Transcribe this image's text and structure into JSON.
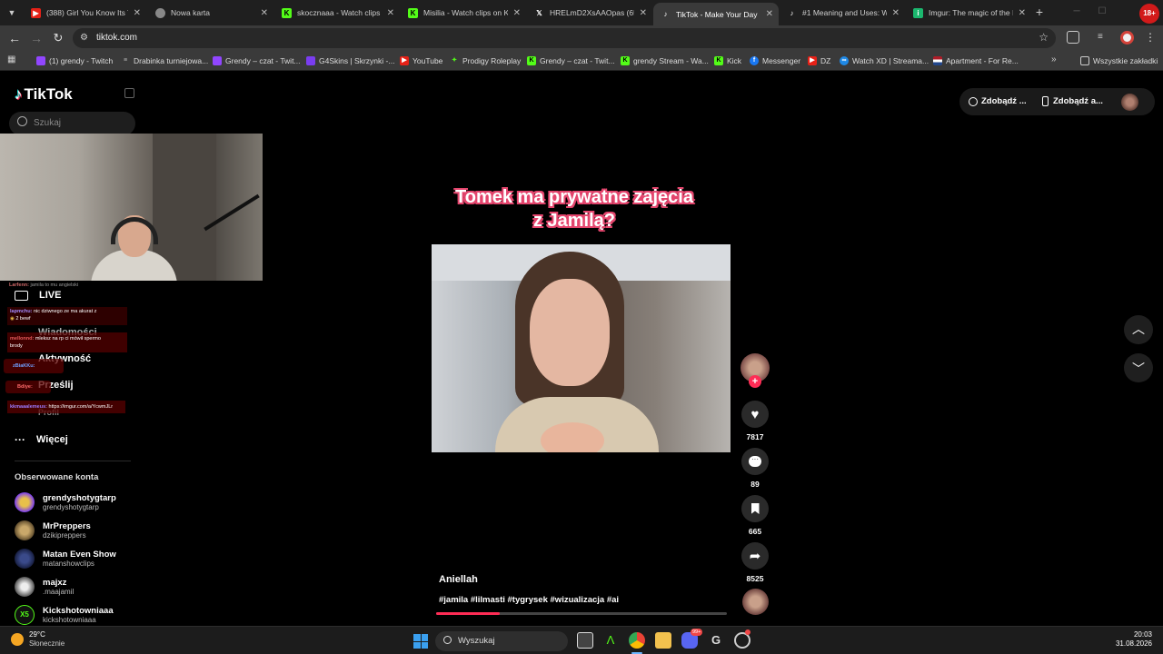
{
  "browser": {
    "tabs": [
      {
        "title": "(388) Girl You Know Its Tr",
        "icon": "youtube-icon"
      },
      {
        "title": "Nowa karta",
        "icon": "chrome-icon"
      },
      {
        "title": "skocznaaa - Watch clips o",
        "icon": "kick-icon"
      },
      {
        "title": "Misilia - Watch clips on K",
        "icon": "kick-icon"
      },
      {
        "title": "HRELmD2XsAAOpas (658",
        "icon": "x-icon"
      },
      {
        "title": "TikTok - Make Your Day",
        "icon": "tiktok-icon"
      },
      {
        "title": "#1 Meaning and Uses: W",
        "icon": "tiktok-icon"
      },
      {
        "title": "Imgur: The magic of the I",
        "icon": "imgur-icon"
      }
    ],
    "url": "tiktok.com",
    "bookmarks": [
      "(1) grendy - Twitch",
      "Drabinka turniejowa...",
      "Grendy – czat - Twit...",
      "G4Skins | Skrzynki -...",
      "YouTube",
      "Prodigy Roleplay",
      "Grendy – czat - Twit...",
      "grendy Stream - Wa...",
      "Kick",
      "Messenger",
      "DZ",
      "Watch XD | Streama...",
      "Apartment - For Re..."
    ],
    "all_bookmarks": "Wszystkie zakładki",
    "profile_badge": "18+"
  },
  "tiktok": {
    "logo": "TikTok",
    "search_placeholder": "Szukaj",
    "nav": [
      "LIVE",
      "Wiadomości",
      "Aktywność",
      "Prześlij",
      "Profil",
      "Więcej"
    ],
    "following_heading": "Obserwowane konta",
    "accounts": [
      {
        "name": "grendyshotygtarp",
        "handle": "grendyshotygtarp"
      },
      {
        "name": "MrPreppers",
        "handle": "dzikipreppers"
      },
      {
        "name": "Matan Even Show",
        "handle": "matanshowclips"
      },
      {
        "name": "majxz",
        "handle": ".maajamil"
      },
      {
        "name": "Kickshotowniaaa",
        "handle": "kickshotowniaaa"
      }
    ],
    "header_buttons": [
      "Zdobądź ...",
      "Zdobądź a..."
    ],
    "video": {
      "caption_line1": "Tomek ma prywatne zajęcia",
      "caption_line2": "z Jamilą?",
      "author": "Aniellah",
      "hashtags": "#jamila #lilmasti #tygrysek #wizualizacja #ai",
      "progress": 0.22
    },
    "actions": {
      "likes": "7817",
      "comments": "89",
      "saves": "665",
      "shares": "8525"
    }
  },
  "stream_chat": [
    {
      "user": "Larfenn:",
      "text": "jamila to mu angielski"
    },
    {
      "user": "lapmchu:",
      "text": "nic dziwnego ze ma akurat z"
    },
    {
      "user": "",
      "text": "2 bewf"
    },
    {
      "user": "mellonnd:",
      "text": "mleksz na rp ci mówił spermo"
    },
    {
      "user": "",
      "text": "brody"
    },
    {
      "user": "zBiaKKu:",
      "text": ""
    },
    {
      "user": "Bdiye:",
      "text": ""
    },
    {
      "user": "kkmaaalemeus:",
      "text": "https://imgur.com/a/YcwmJLr"
    }
  ],
  "taskbar": {
    "weather_temp": "29°C",
    "weather_desc": "Słonecznie",
    "search_placeholder": "Wyszukaj",
    "time": "20:03",
    "date": "31.08.2026",
    "discord_badge": "99+"
  }
}
